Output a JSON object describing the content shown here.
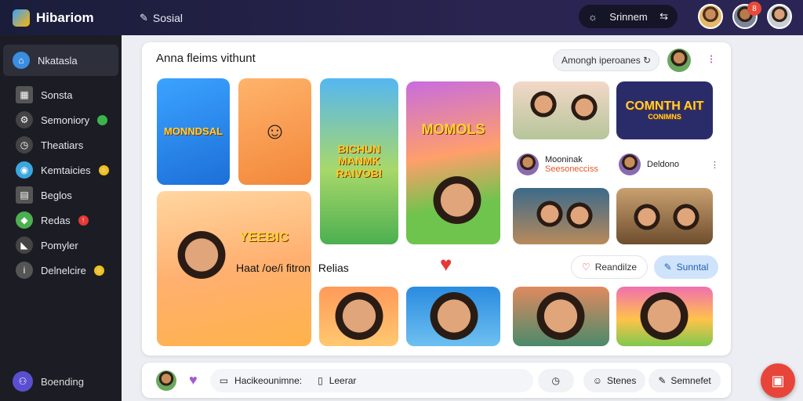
{
  "app": {
    "name": "Hibariom"
  },
  "topbar": {
    "nav_label": "Sosial",
    "pill_label": "Srinnem",
    "notification_count": "8"
  },
  "sidebar": {
    "active": {
      "label": "Nkatasla"
    },
    "items": [
      {
        "label": "Sonsta",
        "icon": "calendar-icon"
      },
      {
        "label": "Semoniory",
        "icon": "gear-icon",
        "badge": "green"
      },
      {
        "label": "Theatiars",
        "icon": "clock-icon"
      },
      {
        "label": "Kemtaicies",
        "icon": "globe-icon",
        "badge": "yellow"
      },
      {
        "label": "Beglos",
        "icon": "calendar-icon"
      },
      {
        "label": "Redas",
        "icon": "map-icon",
        "badge": "red"
      },
      {
        "label": "Pomyler",
        "icon": "megaphone-icon"
      },
      {
        "label": "Delnelcire",
        "icon": "info-icon",
        "badge": "yellow"
      }
    ],
    "footer": {
      "label": "Boending"
    }
  },
  "main": {
    "title": "Anna fleims vithunt",
    "search": "Amongh iperoanes",
    "tiles": {
      "t1": "MONNDSAL",
      "t3": "BICHUN MANMK RAIVOB!",
      "t4": "MOMOLS",
      "t5": "COMNTH AIT",
      "t5b": "CONIMNS",
      "t6": "YEEBIC"
    },
    "section_label": "Haat /oe/i fitron",
    "section_label2": "Relias",
    "profiles": [
      {
        "name": "Mooninak",
        "sub": "Seesonecciss"
      },
      {
        "name": "Deldono",
        "sub": ""
      }
    ],
    "buttons": {
      "left": "Reandilze",
      "right": "Sunntal"
    }
  },
  "bottombar": {
    "input": "Hacikeounimne:",
    "attach": "Leerar",
    "btn1": "Stenes",
    "btn2": "Semnefet"
  },
  "colors": {
    "accent": "#2a2450",
    "fab": "#e8453a"
  }
}
